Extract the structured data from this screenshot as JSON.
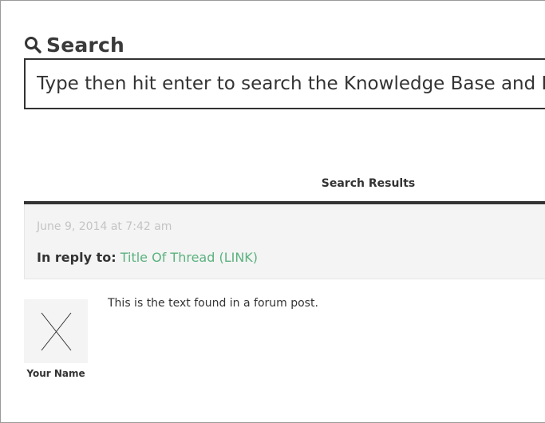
{
  "search": {
    "title": "Search",
    "icon": "search-icon",
    "placeholder": "Type then hit enter to search the Knowledge Base and Forums"
  },
  "results": {
    "header": "Search Results",
    "post": {
      "date": "June 9, 2014 at 7:42 am",
      "reply_label": "In reply to:",
      "thread_link": "Title Of Thread (LINK)",
      "content": "This is the text found in a forum post.",
      "author": {
        "name": "Your Name",
        "avatar_icon": "placeholder-x-icon"
      }
    }
  },
  "colors": {
    "text": "#333333",
    "link": "#5bb27f",
    "muted": "#c4c4c4",
    "panel": "#f4f4f4"
  }
}
